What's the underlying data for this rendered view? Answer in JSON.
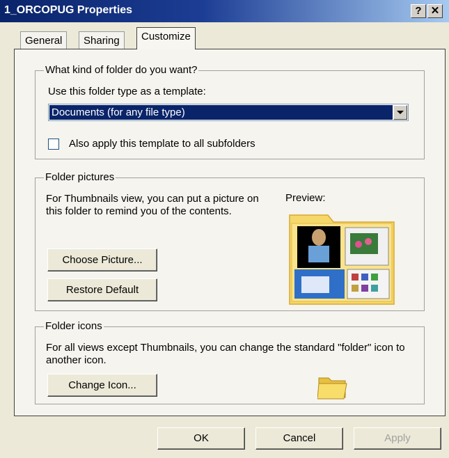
{
  "window": {
    "title": "1_ORCOPUG Properties",
    "help_btn": "?",
    "close_btn": "✕"
  },
  "tabs": [
    {
      "label": "General"
    },
    {
      "label": "Sharing"
    },
    {
      "label": "Customize"
    }
  ],
  "folder_type": {
    "group_title": "What kind of folder do you want?",
    "template_label": "Use this folder type as a template:",
    "selected_value": "Documents (for any file type)",
    "apply_checkbox_label": "Also apply this template to all subfolders"
  },
  "folder_pictures": {
    "group_title": "Folder pictures",
    "description": "For Thumbnails view, you can put a picture on this folder to remind you of the contents.",
    "preview_label": "Preview:",
    "choose_button": "Choose Picture...",
    "restore_button": "Restore Default"
  },
  "folder_icons": {
    "group_title": "Folder icons",
    "description": "For all views except Thumbnails, you can change the standard \"folder\" icon to another icon.",
    "change_button": "Change Icon..."
  },
  "buttons": {
    "ok": "OK",
    "cancel": "Cancel",
    "apply": "Apply"
  }
}
